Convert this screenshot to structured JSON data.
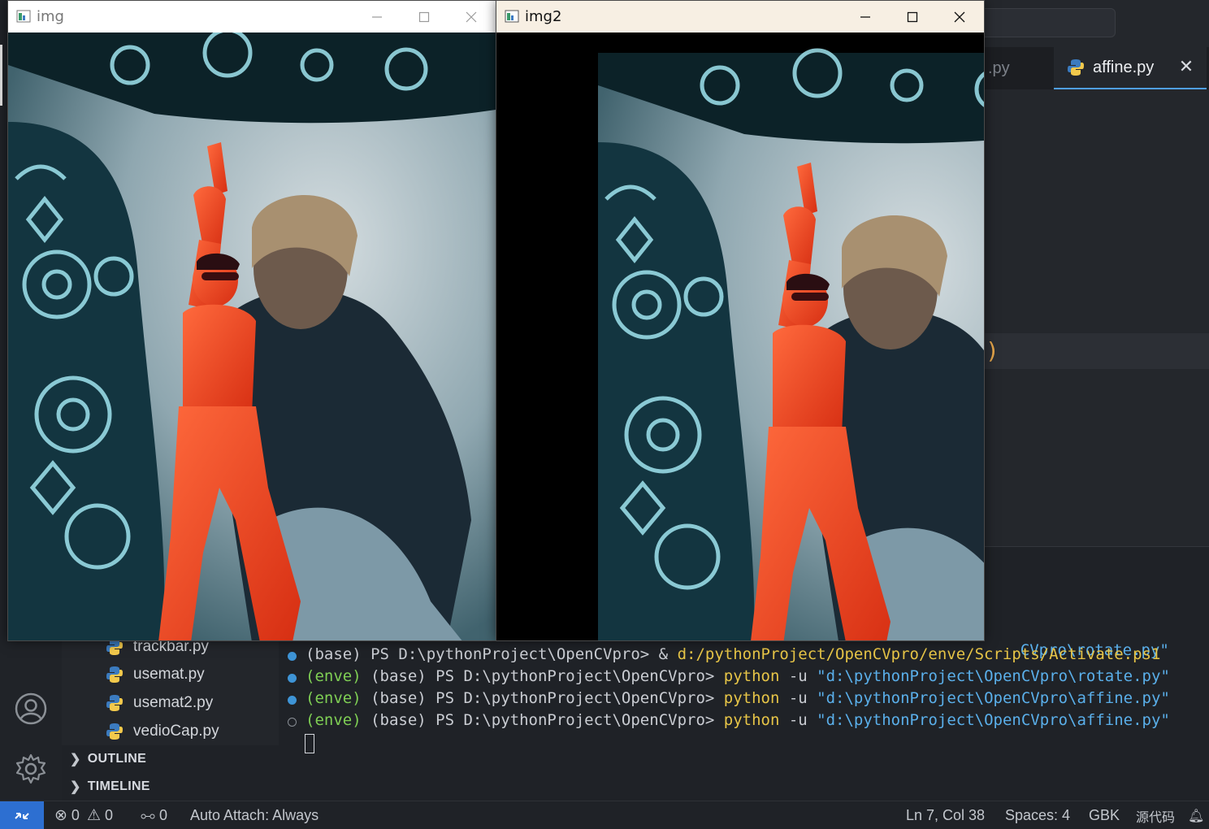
{
  "editor": {
    "tabs": [
      {
        "label": ".py",
        "active": false
      },
      {
        "label": "affine.py",
        "active": true
      }
    ],
    "visible_code_fragment": ")"
  },
  "explorer": {
    "files": [
      "trackbar.py",
      "usemat.py",
      "usemat2.py",
      "vedioCap.py"
    ],
    "sections": [
      "OUTLINE",
      "TIMELINE"
    ]
  },
  "terminal": {
    "partial_line": "CVpro\\rotate.py\"",
    "lines": [
      {
        "dot": "filled",
        "segments": [
          {
            "text": "(base) PS D:\\pythonProject\\OpenCVpro> & ",
            "kind": "plain"
          },
          {
            "text": "d:/pythonProject/OpenCVpro/enve/Scripts/Activate.ps1",
            "kind": "path"
          }
        ]
      },
      {
        "dot": "filled",
        "segments": [
          {
            "text": "(enve)",
            "kind": "enve"
          },
          {
            "text": " (base) PS D:\\pythonProject\\OpenCVpro> ",
            "kind": "plain"
          },
          {
            "text": "python",
            "kind": "cmd"
          },
          {
            "text": " -u ",
            "kind": "plain"
          },
          {
            "text": "\"d:\\pythonProject\\OpenCVpro\\rotate.py\"",
            "kind": "str"
          }
        ]
      },
      {
        "dot": "filled",
        "segments": [
          {
            "text": "(enve)",
            "kind": "enve"
          },
          {
            "text": " (base) PS D:\\pythonProject\\OpenCVpro> ",
            "kind": "plain"
          },
          {
            "text": "python",
            "kind": "cmd"
          },
          {
            "text": " -u ",
            "kind": "plain"
          },
          {
            "text": "\"d:\\pythonProject\\OpenCVpro\\affine.py\"",
            "kind": "str"
          }
        ]
      },
      {
        "dot": "empty",
        "segments": [
          {
            "text": "(enve)",
            "kind": "enve"
          },
          {
            "text": " (base) PS D:\\pythonProject\\OpenCVpro> ",
            "kind": "plain"
          },
          {
            "text": "python",
            "kind": "cmd"
          },
          {
            "text": " -u ",
            "kind": "plain"
          },
          {
            "text": "\"d:\\pythonProject\\OpenCVpro\\affine.py\"",
            "kind": "str"
          }
        ]
      }
    ]
  },
  "statusbar": {
    "errors": "0",
    "warnings": "0",
    "ports": "0",
    "auto_attach": "Auto Attach: Always",
    "cursor_pos": "Ln 7, Col 38",
    "spaces": "Spaces: 4",
    "encoding": "GBK",
    "language": "源代码"
  },
  "windows": {
    "img": {
      "title": "img",
      "active": false
    },
    "img2": {
      "title": "img2",
      "active": true
    }
  },
  "colors": {
    "accent": "#2d6fd1",
    "tab_underline": "#4f9fe6",
    "terminal_env": "#7fcf54",
    "terminal_cmd": "#e7c547",
    "terminal_string": "#5aafea"
  }
}
